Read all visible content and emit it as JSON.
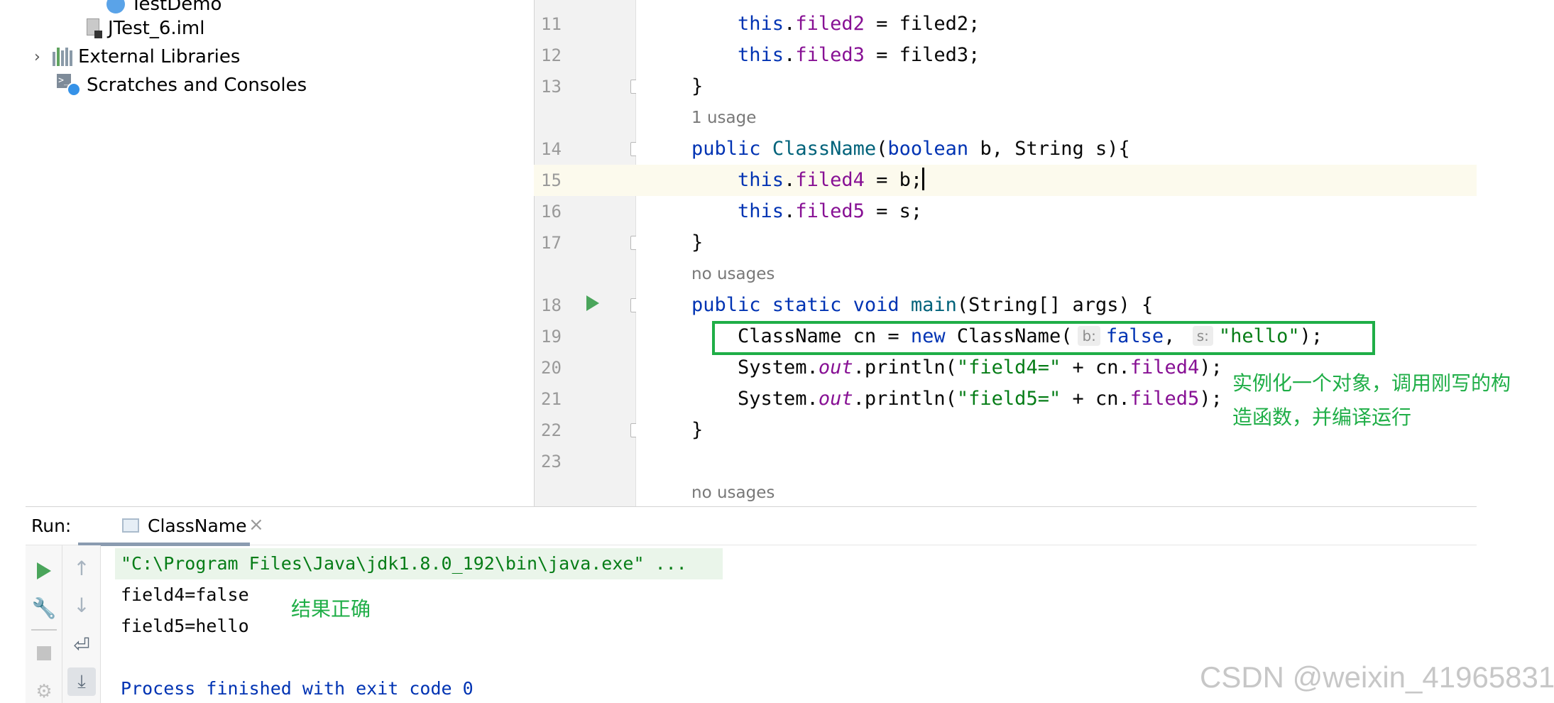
{
  "project_tree": {
    "items": [
      {
        "label": "TestDemo",
        "icon": "java-class-icon"
      },
      {
        "label": "JTest_6.iml",
        "icon": "module-file-icon"
      },
      {
        "label": "External Libraries",
        "icon": "libraries-icon",
        "expandable": true
      },
      {
        "label": "Scratches and Consoles",
        "icon": "scratches-icon"
      }
    ]
  },
  "editor": {
    "lines": [
      {
        "num": "11",
        "text": "    this.filed2 = filed2;"
      },
      {
        "num": "12",
        "text": "    this.filed3 = filed3;"
      },
      {
        "num": "13",
        "text": "}"
      },
      {
        "num": "14",
        "text": "public ClassName(boolean b, String s){"
      },
      {
        "num": "15",
        "text": "    this.filed4 = b;"
      },
      {
        "num": "16",
        "text": "    this.filed5 = s;"
      },
      {
        "num": "17",
        "text": "}"
      },
      {
        "num": "18",
        "text": "public static void main(String[] args) {"
      },
      {
        "num": "19",
        "text": "    ClassName cn = new ClassName( b: false,  s: \"hello\");"
      },
      {
        "num": "20",
        "text": "    System.out.println(\"field4=\" + cn.filed4);"
      },
      {
        "num": "21",
        "text": "    System.out.println(\"field5=\" + cn.filed5);"
      },
      {
        "num": "22",
        "text": "}"
      },
      {
        "num": "23",
        "text": ""
      }
    ],
    "usages": [
      "1 usage",
      "no usages",
      "no usages"
    ],
    "hints": {
      "b": "b:",
      "s": "s:"
    },
    "annotation_line1": "实例化一个对象，调用刚写的构",
    "annotation_line2": "造函数，并编译运行"
  },
  "run_panel": {
    "label": "Run:",
    "tab_label": "ClassName",
    "close": "×",
    "output": [
      "\"C:\\Program Files\\Java\\jdk1.8.0_192\\bin\\java.exe\" ...",
      "field4=false",
      "field5=hello",
      "",
      "Process finished with exit code 0"
    ],
    "annotation": "结果正确"
  },
  "watermark": "CSDN @weixin_41965831",
  "colors": {
    "keyword": "#0033b3",
    "field": "#871094",
    "string": "#067d17",
    "method": "#00627a",
    "annotation_green": "#1fae47"
  }
}
